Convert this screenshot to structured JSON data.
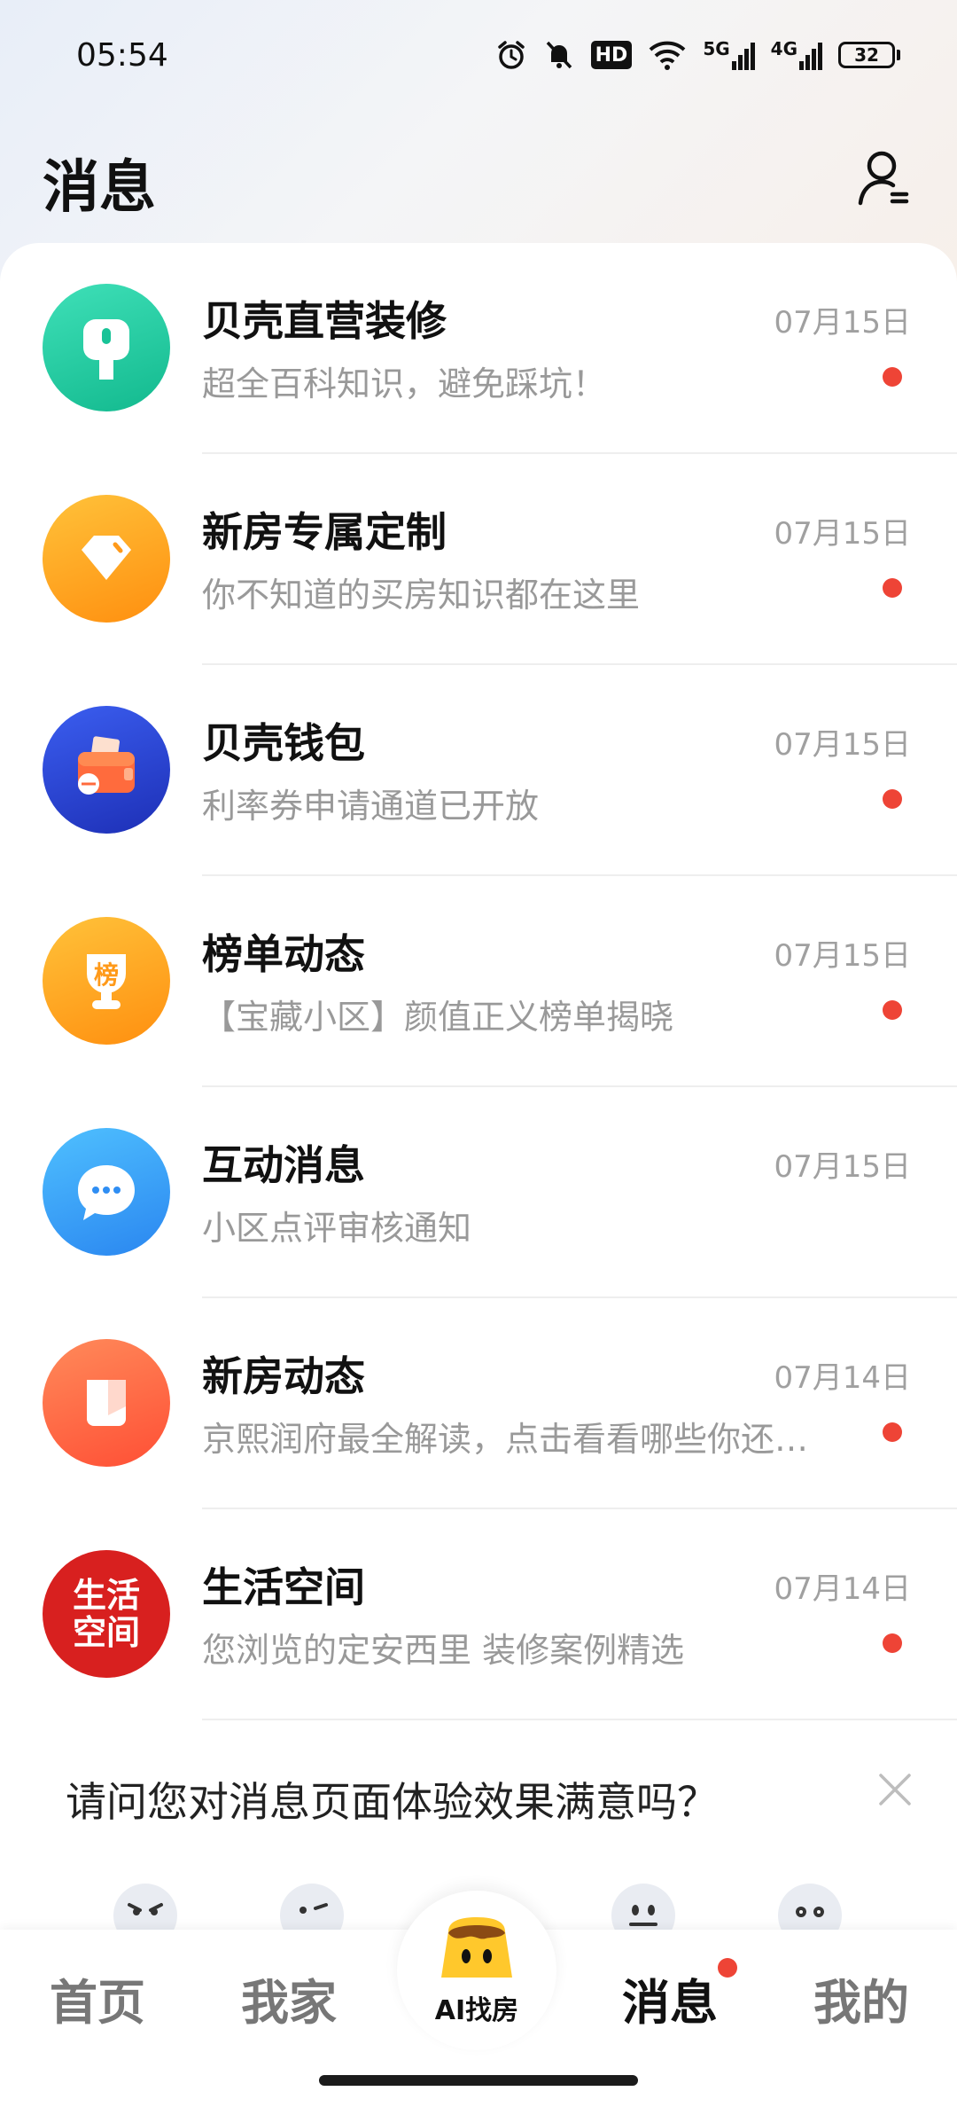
{
  "status_bar": {
    "time": "05:54",
    "battery": "32",
    "network_5g": "5G",
    "network_4g": "4G",
    "hd_label": "HD"
  },
  "header": {
    "title": "消息"
  },
  "messages": [
    {
      "title": "贝壳直营装修",
      "preview": "超全百科知识，避免踩坑！",
      "date": "07月15日",
      "unread": true,
      "icon": "renovation-brush-icon",
      "color": "#21c9a0"
    },
    {
      "title": "新房专属定制",
      "preview": "你不知道的买房知识都在这里",
      "date": "07月15日",
      "unread": true,
      "icon": "diamond-icon",
      "color": "#ffa51a"
    },
    {
      "title": "贝壳钱包",
      "preview": "利率券申请通道已开放",
      "date": "07月15日",
      "unread": true,
      "icon": "wallet-icon",
      "color": "#2f4fd6"
    },
    {
      "title": "榜单动态",
      "preview": "【宝藏小区】颜值正义榜单揭晓",
      "date": "07月15日",
      "unread": true,
      "icon": "trophy-icon",
      "icon_text": "榜",
      "color": "#ffa51a"
    },
    {
      "title": "互动消息",
      "preview": "小区点评审核通知",
      "date": "07月15日",
      "unread": false,
      "icon": "chat-bubble-icon",
      "color": "#3da4f7"
    },
    {
      "title": "新房动态",
      "preview": "京熙润府最全解读，点击看看哪些你还不知道",
      "date": "07月14日",
      "unread": true,
      "icon": "building-icon",
      "color": "#ff6a44"
    },
    {
      "title": "生活空间",
      "preview": "您浏览的定安西里 装修案例精选",
      "date": "07月14日",
      "unread": true,
      "icon": "life-space-logo-icon",
      "icon_text": "生活空间",
      "color": "#d8201f"
    }
  ],
  "feedback": {
    "question": "请问您对消息页面体验效果满意吗？"
  },
  "tabbar": {
    "home": "首页",
    "my_home": "我家",
    "ai": "AI找房",
    "messages": "消息",
    "mine": "我的"
  }
}
